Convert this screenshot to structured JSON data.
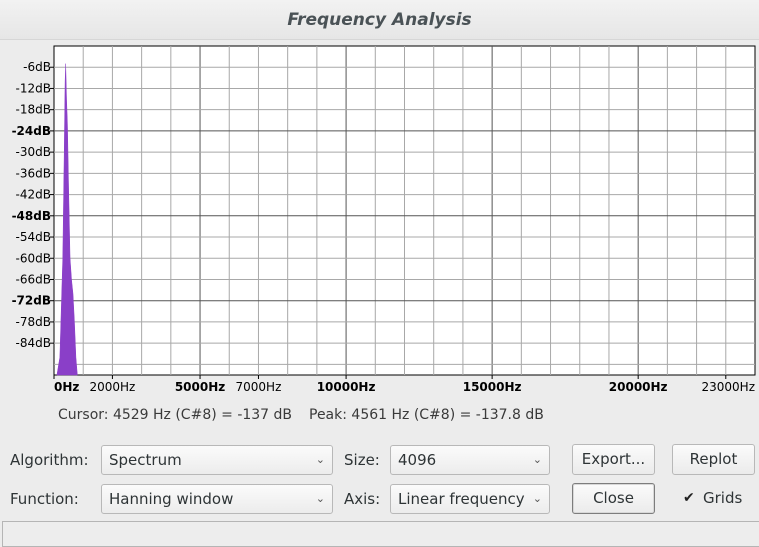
{
  "window": {
    "title": "Frequency Analysis"
  },
  "chart_data": {
    "type": "area",
    "title": "",
    "xlabel": "",
    "ylabel": "",
    "x_tick_labels": [
      "0Hz",
      "2000Hz",
      "5000Hz",
      "7000Hz",
      "10000Hz",
      "15000Hz",
      "20000Hz",
      "23000Hz"
    ],
    "y_tick_labels": [
      "-6dB",
      "-12dB",
      "-18dB",
      "-24dB",
      "-30dB",
      "-36dB",
      "-42dB",
      "-48dB",
      "-54dB",
      "-60dB",
      "-66dB",
      "-72dB",
      "-78dB",
      "-84dB"
    ],
    "ylim": [
      -93,
      0
    ],
    "xlim": [
      0,
      24000
    ],
    "grid": true,
    "series": [
      {
        "color": "#8a3fc8",
        "x": [
          100,
          200,
          300,
          350,
          380,
          400,
          430,
          460,
          500,
          550,
          600,
          650,
          700,
          750,
          800
        ],
        "y": [
          -93,
          -88,
          -60,
          -30,
          -10,
          -5,
          -15,
          -22,
          -40,
          -60,
          -66,
          -70,
          -78,
          -88,
          -93
        ]
      }
    ]
  },
  "status": {
    "cursor": "Cursor: 4529 Hz (C#8) = -137 dB",
    "peak": "Peak: 4561 Hz (C#8) = -137.8 dB"
  },
  "controls": {
    "algorithm_label": "Algorithm:",
    "algorithm_value": "Spectrum",
    "size_label": "Size:",
    "size_value": "4096",
    "function_label": "Function:",
    "function_value": "Hanning window",
    "axis_label": "Axis:",
    "axis_value": "Linear frequency",
    "export_label": "Export...",
    "replot_label": "Replot",
    "close_label": "Close",
    "grids_label": "Grids",
    "grids_checked": true,
    "chevron_glyph": "⌄",
    "check_glyph": "✔"
  }
}
